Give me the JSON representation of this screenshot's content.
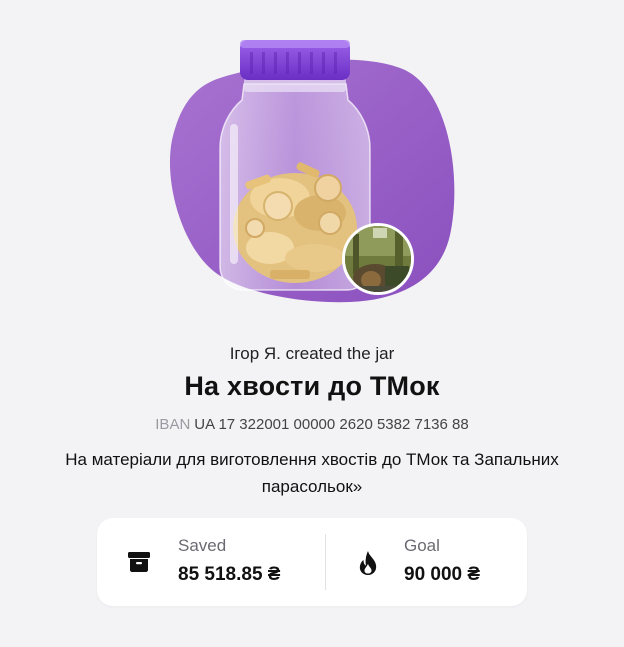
{
  "jar": {
    "creator_text": "Ігор Я. created the jar",
    "title": "На хвости до ТМок",
    "iban_label": "IBAN",
    "iban_value": "UA 17 322001 00000 2620 5382 7136 88",
    "description": "На матеріали для виготовлення хвостів до ТМок та Запальних парасольок»"
  },
  "stats": {
    "saved_label": "Saved",
    "saved_value": "85 518.85 ₴",
    "saved_icon": "archive-box-icon",
    "goal_label": "Goal",
    "goal_value": "90 000 ₴",
    "goal_icon": "flame-icon"
  },
  "colors": {
    "background": "#f3f3f5",
    "blob": "#9a63c6",
    "jar_lid": "#7f3fd6",
    "coin": "#e7c98c"
  }
}
